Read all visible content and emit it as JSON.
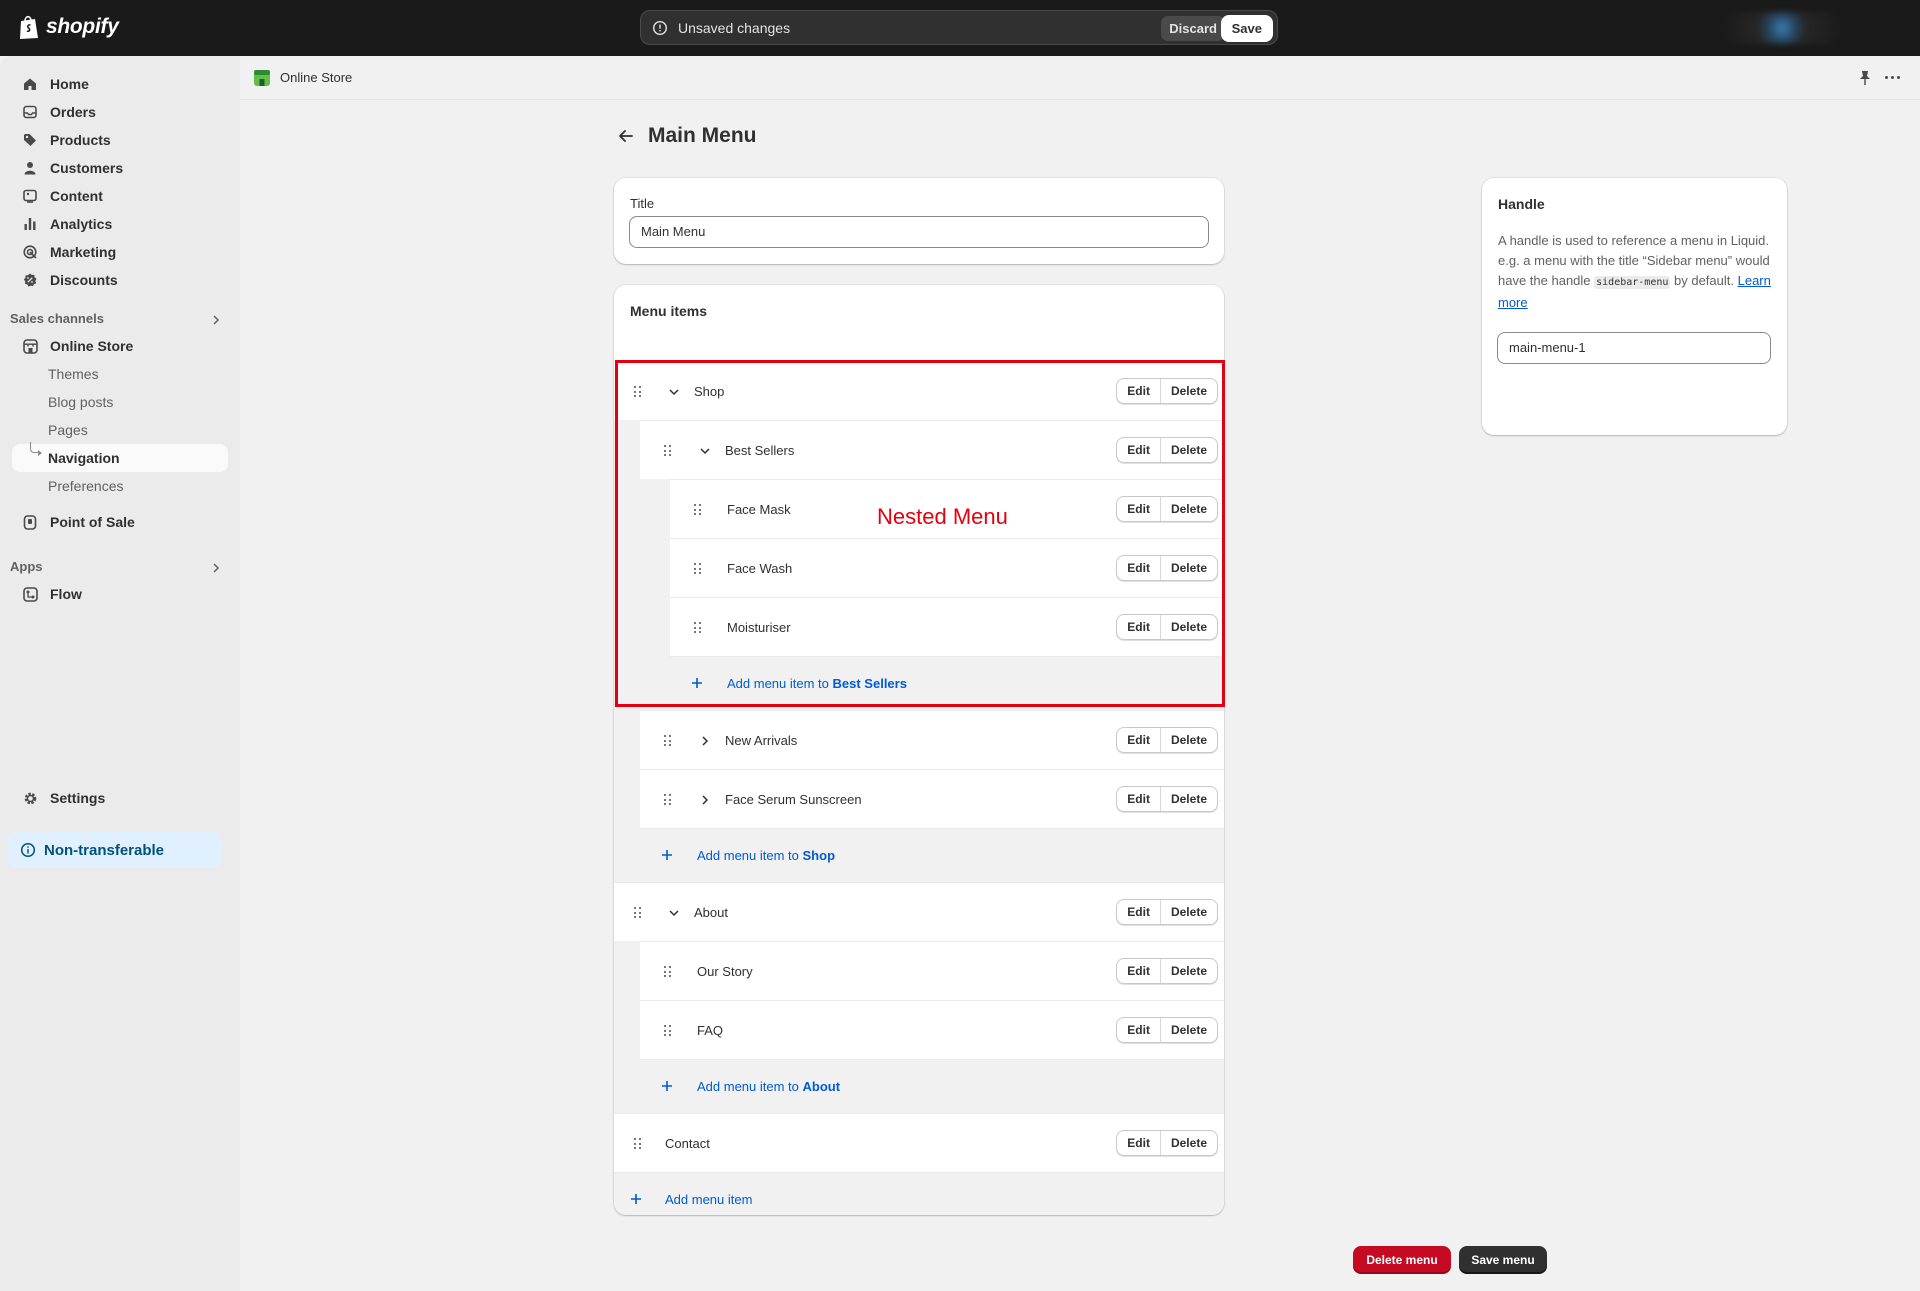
{
  "topbar": {
    "brand": "shopify",
    "unsaved_text": "Unsaved changes",
    "discard_label": "Discard",
    "save_label": "Save"
  },
  "sidebar": {
    "main_items": [
      {
        "label": "Home",
        "icon": "home-icon"
      },
      {
        "label": "Orders",
        "icon": "inbox-icon"
      },
      {
        "label": "Products",
        "icon": "tag-icon"
      },
      {
        "label": "Customers",
        "icon": "person-icon"
      },
      {
        "label": "Content",
        "icon": "image-icon"
      },
      {
        "label": "Analytics",
        "icon": "bar-chart-icon"
      },
      {
        "label": "Marketing",
        "icon": "target-icon"
      },
      {
        "label": "Discounts",
        "icon": "discount-icon"
      }
    ],
    "sales_channels_label": "Sales channels",
    "online_store_label": "Online Store",
    "online_store_sub": [
      "Themes",
      "Blog posts",
      "Pages",
      "Navigation",
      "Preferences"
    ],
    "active_sub": "Navigation",
    "point_of_sale_label": "Point of Sale",
    "apps_label": "Apps",
    "flow_label": "Flow",
    "settings_label": "Settings",
    "non_transferable_label": "Non-transferable"
  },
  "store_header": {
    "title": "Online Store"
  },
  "page": {
    "title": "Main Menu"
  },
  "title_card": {
    "label": "Title",
    "value": "Main Menu"
  },
  "menu_items": {
    "heading": "Menu items",
    "edit_label": "Edit",
    "delete_label": "Delete",
    "rows": {
      "shop": "Shop",
      "best_sellers": "Best Sellers",
      "face_mask": "Face Mask",
      "face_wash": "Face Wash",
      "moisturiser": "Moisturiser",
      "new_arrivals": "New Arrivals",
      "face_serum": "Face Serum Sunscreen",
      "about": "About",
      "our_story": "Our Story",
      "faq": "FAQ",
      "contact": "Contact"
    },
    "add_prefix": "Add menu item to",
    "add_best_sellers_target": "Best Sellers",
    "add_shop_target": "Shop",
    "add_about_target": "About",
    "add_root": "Add menu item"
  },
  "handle_card": {
    "title": "Handle",
    "desc_part1": "A handle is used to reference a menu in Liquid. e.g. a menu with the title “Sidebar menu” would have the handle ",
    "desc_code": "sidebar-menu",
    "desc_part2": " by default. ",
    "learn_more": "Learn more",
    "value": "main-menu-1"
  },
  "annotation": {
    "text": "Nested Menu",
    "color": "#e4000f"
  },
  "footer": {
    "delete_menu_label": "Delete menu",
    "save_menu_label": "Save menu"
  },
  "colors": {
    "link": "#005bd3",
    "danger": "#c70a24",
    "topbar": "#1a1a1a"
  }
}
